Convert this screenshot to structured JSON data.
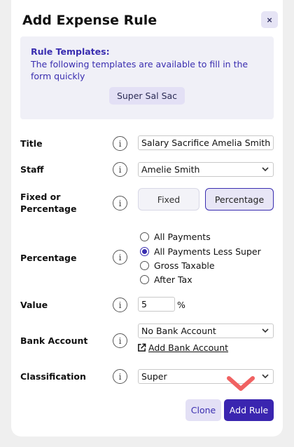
{
  "modal": {
    "title": "Add Expense Rule",
    "close_icon": "close-icon",
    "close_label": "×"
  },
  "templates": {
    "heading": "Rule Templates:",
    "description": "The following templates are available to fill in the form quickly",
    "buttons": [
      "Super Sal Sac"
    ]
  },
  "form": {
    "info_icon": "info-icon",
    "info_glyph": "i",
    "title": {
      "label": "Title",
      "value": "Salary Sacrifice Amelia Smith"
    },
    "staff": {
      "label": "Staff",
      "value": "Amelie Smith"
    },
    "fixed_or_percentage": {
      "label": "Fixed or Percentage",
      "options": [
        "Fixed",
        "Percentage"
      ],
      "selected": "Percentage"
    },
    "percentage": {
      "label": "Percentage",
      "options": [
        "All Payments",
        "All Payments Less Super",
        "Gross Taxable",
        "After Tax"
      ],
      "selected": "All Payments Less Super"
    },
    "value": {
      "label": "Value",
      "value": "5",
      "unit": "%"
    },
    "bank_account": {
      "label": "Bank Account",
      "value": "No Bank Account",
      "add_link": "Add Bank Account",
      "add_icon": "external-link-icon"
    },
    "classification": {
      "label": "Classification",
      "value": "Super"
    }
  },
  "actions": {
    "clone": "Clone",
    "add_rule": "Add Rule"
  },
  "colors": {
    "accent": "#3a25b0",
    "accent_light": "#e3e0f5",
    "marker": "#f06262"
  }
}
